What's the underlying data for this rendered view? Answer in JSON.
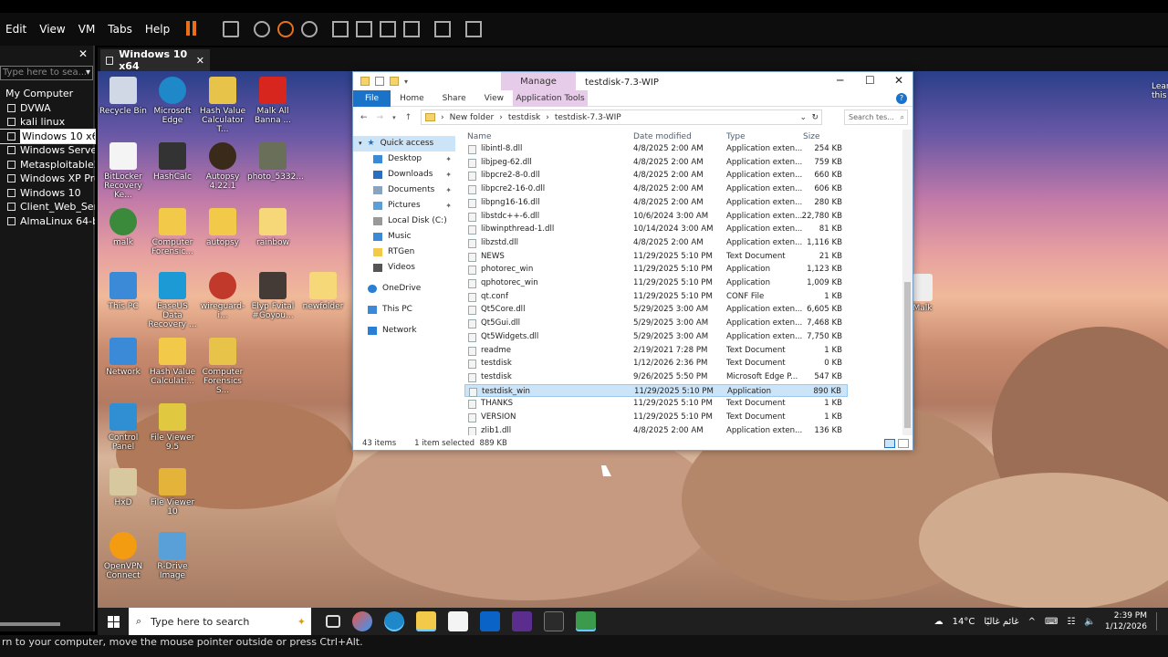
{
  "menu": [
    "Edit",
    "View",
    "VM",
    "Tabs",
    "Help"
  ],
  "library": {
    "search_placeholder": "Type here to sea...",
    "root": "My Computer",
    "items": [
      "DVWA",
      "kali linux",
      "Windows 10 x64",
      "Windows Server 2",
      "Metasploitable2-",
      "Windows XP Prof",
      "Windows 10",
      "Client_Web_Serve",
      "AlmaLinux 64-bit"
    ],
    "selected_index": 2
  },
  "vm_tab": {
    "title": "Windows 10 x64"
  },
  "desktop_icons": [
    "Recycle Bin",
    "Microsoft Edge",
    "Hash Value Calculator T...",
    "Malk All Banna ...",
    "BitLocker Recovery Ke...",
    "HashCalc",
    "Autopsy 4.22.1",
    "photo_5332...",
    "malk",
    "Computer Forensic...",
    "autopsy",
    "rainbow",
    "This PC",
    "EaseUS Data Recovery ...",
    "wireguard-i...",
    "Elyp Fvital #Goyou...",
    "newfolder",
    "Network",
    "Hash Value Calculati...",
    "Computer Forensics S...",
    "Control Panel",
    "File Viewer 9.5",
    "HxD",
    "File Viewer 10",
    "OpenVPN Connect",
    "R-Drive Image"
  ],
  "right_edge_icons": [
    "Learn this p",
    "Malk"
  ],
  "explorer": {
    "contextual_tab": "Manage",
    "window_title": "testdisk-7.3-WIP",
    "ribbon": [
      "File",
      "Home",
      "Share",
      "View",
      "Application Tools"
    ],
    "breadcrumb": [
      "New folder",
      "testdisk",
      "testdisk-7.3-WIP"
    ],
    "search_placeholder": "Search tes...",
    "nav": [
      {
        "label": "Quick access",
        "pin": false
      },
      {
        "label": "Desktop",
        "pin": true
      },
      {
        "label": "Downloads",
        "pin": true
      },
      {
        "label": "Documents",
        "pin": true
      },
      {
        "label": "Pictures",
        "pin": true
      },
      {
        "label": "Local Disk (C:)",
        "pin": false
      },
      {
        "label": "Music",
        "pin": false
      },
      {
        "label": "RTGen",
        "pin": false
      },
      {
        "label": "Videos",
        "pin": false
      },
      {
        "label": "OneDrive",
        "pin": false
      },
      {
        "label": "This PC",
        "pin": false
      },
      {
        "label": "Network",
        "pin": false
      }
    ],
    "columns": [
      "Name",
      "Date modified",
      "Type",
      "Size"
    ],
    "files": [
      [
        "libintl-8.dll",
        "4/8/2025 2:00 AM",
        "Application exten...",
        "254 KB"
      ],
      [
        "libjpeg-62.dll",
        "4/8/2025 2:00 AM",
        "Application exten...",
        "759 KB"
      ],
      [
        "libpcre2-8-0.dll",
        "4/8/2025 2:00 AM",
        "Application exten...",
        "660 KB"
      ],
      [
        "libpcre2-16-0.dll",
        "4/8/2025 2:00 AM",
        "Application exten...",
        "606 KB"
      ],
      [
        "libpng16-16.dll",
        "4/8/2025 2:00 AM",
        "Application exten...",
        "280 KB"
      ],
      [
        "libstdc++-6.dll",
        "10/6/2024 3:00 AM",
        "Application exten...",
        "22,780 KB"
      ],
      [
        "libwinpthread-1.dll",
        "10/14/2024 3:00 AM",
        "Application exten...",
        "81 KB"
      ],
      [
        "libzstd.dll",
        "4/8/2025 2:00 AM",
        "Application exten...",
        "1,116 KB"
      ],
      [
        "NEWS",
        "11/29/2025 5:10 PM",
        "Text Document",
        "21 KB"
      ],
      [
        "photorec_win",
        "11/29/2025 5:10 PM",
        "Application",
        "1,123 KB"
      ],
      [
        "qphotorec_win",
        "11/29/2025 5:10 PM",
        "Application",
        "1,009 KB"
      ],
      [
        "qt.conf",
        "11/29/2025 5:10 PM",
        "CONF File",
        "1 KB"
      ],
      [
        "Qt5Core.dll",
        "5/29/2025 3:00 AM",
        "Application exten...",
        "6,605 KB"
      ],
      [
        "Qt5Gui.dll",
        "5/29/2025 3:00 AM",
        "Application exten...",
        "7,468 KB"
      ],
      [
        "Qt5Widgets.dll",
        "5/29/2025 3:00 AM",
        "Application exten...",
        "7,750 KB"
      ],
      [
        "readme",
        "2/19/2021 7:28 PM",
        "Text Document",
        "1 KB"
      ],
      [
        "testdisk",
        "1/12/2026 2:36 PM",
        "Text Document",
        "0 KB"
      ],
      [
        "testdisk",
        "9/26/2025 5:50 PM",
        "Microsoft Edge P...",
        "547 KB"
      ],
      [
        "testdisk_win",
        "11/29/2025 5:10 PM",
        "Application",
        "890 KB"
      ],
      [
        "THANKS",
        "11/29/2025 5:10 PM",
        "Text Document",
        "1 KB"
      ],
      [
        "VERSION",
        "11/29/2025 5:10 PM",
        "Text Document",
        "1 KB"
      ],
      [
        "zlib1.dll",
        "4/8/2025 2:00 AM",
        "Application exten...",
        "136 KB"
      ]
    ],
    "selected_row": 18,
    "status_items": "43 items",
    "status_selected": "1 item selected  889 KB"
  },
  "taskbar": {
    "search_placeholder": "Type here to search",
    "weather": "14°C",
    "weather_desc": "غائم غالبًا",
    "time": "2:39 PM",
    "date": "1/12/2026"
  },
  "hint": "rn to your computer, move the mouse pointer outside or press Ctrl+Alt."
}
